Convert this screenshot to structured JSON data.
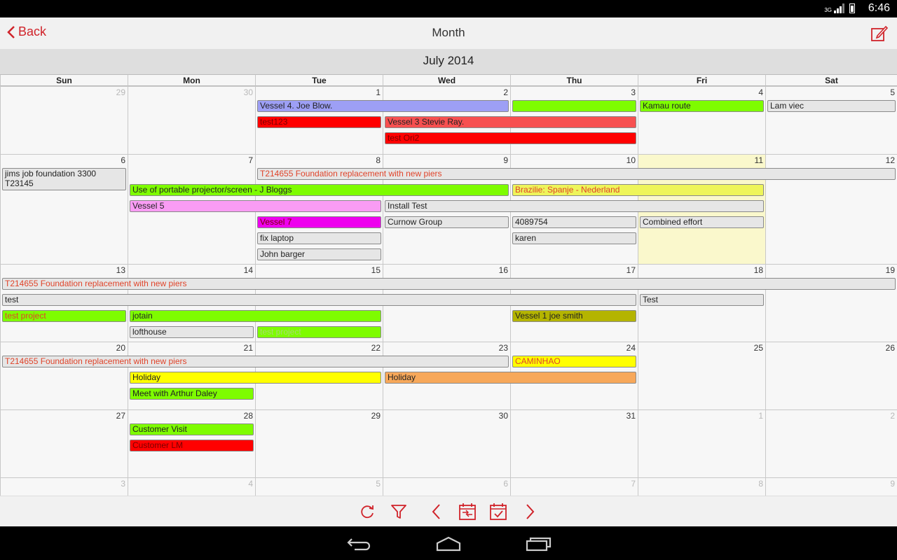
{
  "status": {
    "network": "3G",
    "time": "6:46"
  },
  "header": {
    "back_label": "Back",
    "title": "Month"
  },
  "month_label": "July 2014",
  "weekdays": [
    "Sun",
    "Mon",
    "Tue",
    "Wed",
    "Thu",
    "Fri",
    "Sat"
  ],
  "weeks": [
    {
      "days": [
        {
          "n": "29",
          "other": true
        },
        {
          "n": "30",
          "other": true
        },
        {
          "n": "1"
        },
        {
          "n": "2"
        },
        {
          "n": "3"
        },
        {
          "n": "4"
        },
        {
          "n": "5"
        }
      ]
    },
    {
      "days": [
        {
          "n": "6"
        },
        {
          "n": "7"
        },
        {
          "n": "8"
        },
        {
          "n": "9"
        },
        {
          "n": "10"
        },
        {
          "n": "11",
          "today": true
        },
        {
          "n": "12"
        }
      ]
    },
    {
      "days": [
        {
          "n": "13"
        },
        {
          "n": "14"
        },
        {
          "n": "15"
        },
        {
          "n": "16"
        },
        {
          "n": "17"
        },
        {
          "n": "18"
        },
        {
          "n": "19"
        }
      ]
    },
    {
      "days": [
        {
          "n": "20"
        },
        {
          "n": "21"
        },
        {
          "n": "22"
        },
        {
          "n": "23"
        },
        {
          "n": "24"
        },
        {
          "n": "25"
        },
        {
          "n": "26"
        }
      ]
    },
    {
      "days": [
        {
          "n": "27"
        },
        {
          "n": "28"
        },
        {
          "n": "29"
        },
        {
          "n": "30"
        },
        {
          "n": "31"
        },
        {
          "n": "1",
          "other": true
        },
        {
          "n": "2",
          "other": true
        }
      ]
    },
    {
      "days": [
        {
          "n": "3",
          "other": true
        },
        {
          "n": "4",
          "other": true
        },
        {
          "n": "5",
          "other": true
        },
        {
          "n": "6",
          "other": true
        },
        {
          "n": "7",
          "other": true
        },
        {
          "n": "8",
          "other": true
        },
        {
          "n": "9",
          "other": true
        }
      ]
    }
  ],
  "events": [
    {
      "week": 0,
      "row": 0,
      "start": 2,
      "span": 2,
      "title": "Vessel 4. Joe Blow.",
      "bg": "#9d9ff5",
      "fg": "#222222"
    },
    {
      "week": 0,
      "row": 0,
      "start": 4,
      "span": 1,
      "title": "",
      "bg": "#7efc00",
      "fg": "#222222"
    },
    {
      "week": 0,
      "row": 0,
      "start": 5,
      "span": 1,
      "title": "Kamau route",
      "bg": "#7efc00",
      "fg": "#222222"
    },
    {
      "week": 0,
      "row": 0,
      "start": 6,
      "span": 1,
      "title": "Lam viec",
      "bg": "#e6e6e6",
      "fg": "#222222"
    },
    {
      "week": 0,
      "row": 1,
      "start": 2,
      "span": 1,
      "title": "test123",
      "bg": "#ff0000",
      "fg": "#7a0000"
    },
    {
      "week": 0,
      "row": 1,
      "start": 3,
      "span": 2,
      "title": "Vessel 3 Stevie Ray.",
      "bg": "#f75050",
      "fg": "#222222"
    },
    {
      "week": 0,
      "row": 2,
      "start": 3,
      "span": 2,
      "title": "test Ori2",
      "bg": "#ff0000",
      "fg": "#7a0000"
    },
    {
      "week": 1,
      "row": 0,
      "start": 0,
      "span": 1,
      "title": "jims job foundation 3300 T23145",
      "bg": "#e6e6e6",
      "fg": "#222222",
      "tall": true
    },
    {
      "week": 1,
      "row": 0,
      "start": 2,
      "span": 5,
      "title": "T214655 Foundation replacement with new piers",
      "bg": "#e6e6e6",
      "fg": "#e0442a"
    },
    {
      "week": 1,
      "row": 1,
      "start": 1,
      "span": 3,
      "title": "Use of portable projector/screen - J Bloggs",
      "bg": "#7efc00",
      "fg": "#222222"
    },
    {
      "week": 1,
      "row": 1,
      "start": 4,
      "span": 2,
      "title": "Brazilie: Spanje - Nederland",
      "bg": "#eef55a",
      "fg": "#e0442a"
    },
    {
      "week": 1,
      "row": 2,
      "start": 1,
      "span": 2,
      "title": "Vessel 5",
      "bg": "#f99cf4",
      "fg": "#222222"
    },
    {
      "week": 1,
      "row": 2,
      "start": 3,
      "span": 3,
      "title": "Install Test",
      "bg": "#e6e6e6",
      "fg": "#222222"
    },
    {
      "week": 1,
      "row": 3,
      "start": 2,
      "span": 1,
      "title": "Vessel 7",
      "bg": "#ee00ee",
      "fg": "#7a0000"
    },
    {
      "week": 1,
      "row": 3,
      "start": 3,
      "span": 1,
      "title": "Curnow Group",
      "bg": "#e6e6e6",
      "fg": "#222222"
    },
    {
      "week": 1,
      "row": 3,
      "start": 4,
      "span": 1,
      "title": "4089754",
      "bg": "#e6e6e6",
      "fg": "#222222"
    },
    {
      "week": 1,
      "row": 3,
      "start": 5,
      "span": 1,
      "title": "Combined effort",
      "bg": "#e6e6e6",
      "fg": "#222222"
    },
    {
      "week": 1,
      "row": 4,
      "start": 2,
      "span": 1,
      "title": "fix laptop",
      "bg": "#e6e6e6",
      "fg": "#222222"
    },
    {
      "week": 1,
      "row": 4,
      "start": 4,
      "span": 1,
      "title": "karen",
      "bg": "#e6e6e6",
      "fg": "#222222"
    },
    {
      "week": 1,
      "row": 5,
      "start": 2,
      "span": 1,
      "title": "John barger",
      "bg": "#e6e6e6",
      "fg": "#222222"
    },
    {
      "week": 2,
      "row": 0,
      "start": 0,
      "span": 7,
      "title": "T214655 Foundation replacement with new piers",
      "bg": "#e6e6e6",
      "fg": "#e0442a"
    },
    {
      "week": 2,
      "row": 1,
      "start": 0,
      "span": 5,
      "title": "test",
      "bg": "#e6e6e6",
      "fg": "#222222"
    },
    {
      "week": 2,
      "row": 1,
      "start": 5,
      "span": 1,
      "title": "Test",
      "bg": "#e6e6e6",
      "fg": "#222222"
    },
    {
      "week": 2,
      "row": 2,
      "start": 0,
      "span": 1,
      "title": "test project",
      "bg": "#7efc00",
      "fg": "#e0442a"
    },
    {
      "week": 2,
      "row": 2,
      "start": 1,
      "span": 2,
      "title": "jotain",
      "bg": "#7efc00",
      "fg": "#222222"
    },
    {
      "week": 2,
      "row": 2,
      "start": 4,
      "span": 1,
      "title": "Vessel 1 joe smith",
      "bg": "#b4b400",
      "fg": "#222222"
    },
    {
      "week": 2,
      "row": 3,
      "start": 1,
      "span": 1,
      "title": "lofthouse",
      "bg": "#e6e6e6",
      "fg": "#222222"
    },
    {
      "week": 2,
      "row": 3,
      "start": 2,
      "span": 1,
      "title": "test project",
      "bg": "#7efc00",
      "fg": "#a8d878"
    },
    {
      "week": 3,
      "row": 0,
      "start": 0,
      "span": 4,
      "title": "T214655 Foundation replacement with new piers",
      "bg": "#e6e6e6",
      "fg": "#e0442a"
    },
    {
      "week": 3,
      "row": 0,
      "start": 4,
      "span": 1,
      "title": "CAMINHAO",
      "bg": "#ffff00",
      "fg": "#e0442a"
    },
    {
      "week": 3,
      "row": 1,
      "start": 1,
      "span": 2,
      "title": "Holiday",
      "bg": "#ffff00",
      "fg": "#222222"
    },
    {
      "week": 3,
      "row": 1,
      "start": 3,
      "span": 2,
      "title": "Holiday",
      "bg": "#f7a85a",
      "fg": "#222222"
    },
    {
      "week": 3,
      "row": 2,
      "start": 1,
      "span": 1,
      "title": "Meet with Arthur Daley",
      "bg": "#7efc00",
      "fg": "#222222"
    },
    {
      "week": 4,
      "row": 0,
      "start": 1,
      "span": 1,
      "title": "Customer Visit",
      "bg": "#7efc00",
      "fg": "#222222"
    },
    {
      "week": 4,
      "row": 1,
      "start": 1,
      "span": 1,
      "title": "Customer LM",
      "bg": "#ff0000",
      "fg": "#7a0000"
    }
  ],
  "toolbar": [
    "refresh-icon",
    "filter-icon",
    "previous-icon",
    "go-to-date-icon",
    "today-icon",
    "next-icon"
  ],
  "accent": "#d0232a"
}
